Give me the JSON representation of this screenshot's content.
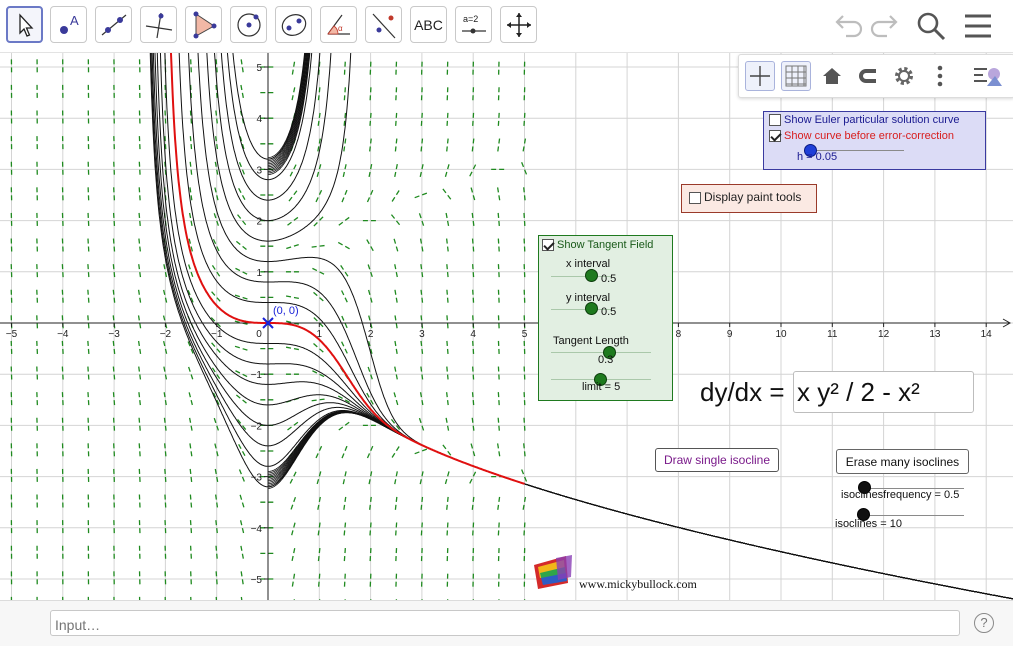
{
  "toolbar": {
    "tools": [
      {
        "name": "move-tool-icon",
        "label": ""
      },
      {
        "name": "point-tool-icon",
        "label": "A"
      },
      {
        "name": "line-tool-icon",
        "label": ""
      },
      {
        "name": "perpendicular-tool-icon",
        "label": ""
      },
      {
        "name": "polygon-tool-icon",
        "label": ""
      },
      {
        "name": "circle-tool-icon",
        "label": ""
      },
      {
        "name": "ellipse-tool-icon",
        "label": ""
      },
      {
        "name": "angle-tool-icon",
        "label": ""
      },
      {
        "name": "reflect-tool-icon",
        "label": ""
      },
      {
        "name": "text-tool-icon",
        "label": "ABC"
      },
      {
        "name": "slider-tool-icon",
        "label": "a=2"
      },
      {
        "name": "move-view-tool-icon",
        "label": ""
      }
    ],
    "right_icons": [
      "undo-icon",
      "redo-icon",
      "search-icon",
      "menu-icon"
    ]
  },
  "stylebar": {
    "icons": [
      "axes-toggle-icon",
      "grid-toggle-icon",
      "home-icon",
      "magnet-icon",
      "gear-icon",
      "more-icon",
      "graphics-menu-icon"
    ]
  },
  "graph": {
    "x_tick_labels": [
      "−5",
      "−4",
      "−3",
      "−2",
      "−1",
      "0",
      "1",
      "2",
      "3",
      "4",
      "5",
      "6",
      "7",
      "8",
      "9",
      "10",
      "11",
      "12",
      "13",
      "14"
    ],
    "y_tick_labels": [
      "5",
      "4",
      "3",
      "2",
      "1",
      "−1",
      "−2",
      "−3",
      "−4",
      "−5"
    ],
    "origin_label": "(0, 0)",
    "point_color": "#1a22d8",
    "particular_curve_color": "#e01010",
    "field_color": "#1f8a1f"
  },
  "euler_panel": {
    "show_euler_label": "Show Euler particular solution curve",
    "show_euler_checked": false,
    "show_curve_label": "Show curve before error-correction",
    "show_curve_checked": true,
    "h_label": "h = 0.05",
    "h_value": 0.05
  },
  "paint_panel": {
    "label": "Display paint tools",
    "checked": false
  },
  "tangent_panel": {
    "show_label": "Show Tangent Field",
    "checked": true,
    "x_interval_title": "x interval",
    "x_interval_value": "0.5",
    "y_interval_title": "y interval",
    "y_interval_value": "0.5",
    "tangent_length_title": "Tangent Length",
    "tangent_length_value": "0.3",
    "limit_label": "limit = 5"
  },
  "equation": {
    "label": "dy/dx =",
    "value": "x y² / 2 - x²"
  },
  "isoclines": {
    "draw_single_label": "Draw single isocline",
    "erase_many_label": "Erase many isoclines",
    "frequency_label": "isoclinesfrequency = 0.5",
    "count_label": "isoclines = 10"
  },
  "website": "www.mickybullock.com",
  "input": {
    "placeholder": "Input…"
  },
  "help_label": "?"
}
